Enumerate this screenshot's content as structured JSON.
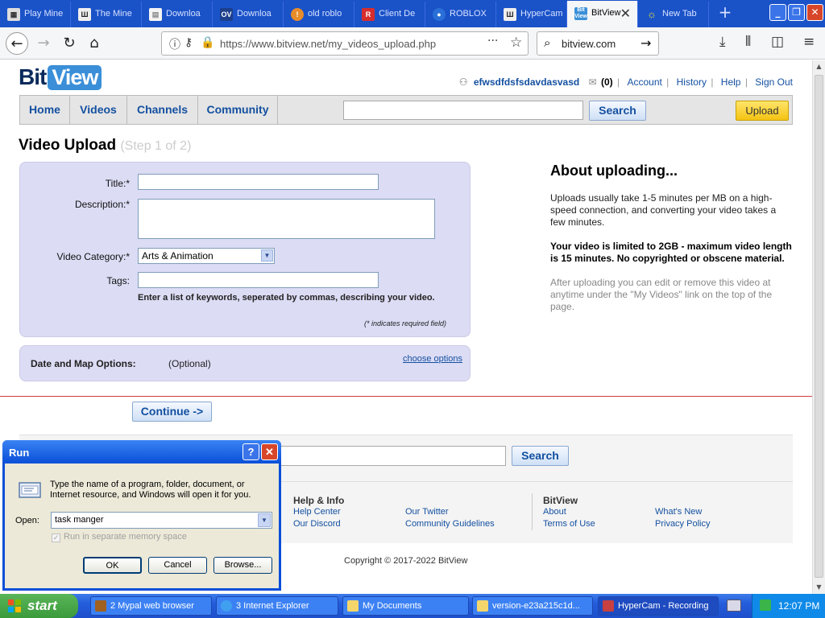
{
  "browser": {
    "tabs": [
      {
        "label": "Play Mine",
        "icon": "grid-icon"
      },
      {
        "label": "The Mine",
        "icon": "museum-icon"
      },
      {
        "label": "Downloa",
        "icon": "page-icon"
      },
      {
        "label": "Downloa",
        "icon": "ov-icon"
      },
      {
        "label": "old roblo",
        "icon": "roblox-icon"
      },
      {
        "label": "Client De",
        "icon": "roblox-r-icon"
      },
      {
        "label": "ROBLOX",
        "icon": "eye-icon"
      },
      {
        "label": "HyperCam",
        "icon": "museum-icon"
      },
      {
        "label": "BitView",
        "icon": "bitview-icon"
      },
      {
        "label": "New Tab",
        "icon": "bug-icon"
      }
    ],
    "url": "https://www.bitview.net/my_videos_upload.php",
    "search_value": "bitview.com"
  },
  "site": {
    "logo_bit": "Bit",
    "logo_view": "View",
    "username": "efwsdfdsfsdavdasvasd",
    "messages_count": "(0)",
    "user_links": [
      "Account",
      "History",
      "Help",
      "Sign Out"
    ],
    "nav": [
      "Home",
      "Videos",
      "Channels",
      "Community"
    ],
    "search_button": "Search",
    "upload_button": "Upload"
  },
  "upload": {
    "title": "Video Upload",
    "step": "(Step 1 of 2)",
    "title_label": "Title:*",
    "description_label": "Description:*",
    "category_label": "Video Category:*",
    "category_value": "Arts & Animation",
    "tags_label": "Tags:",
    "tags_hint": "Enter a list of keywords, seperated by commas, describing your video.",
    "required_note": "(* indicates required field)",
    "date_map_label": "Date and Map Options:",
    "optional": "(Optional)",
    "choose_options": "choose options",
    "continue_button": "Continue ->"
  },
  "about": {
    "heading": "About uploading...",
    "p1": "Uploads usually take 1-5 minutes per MB on a high-speed connection, and converting your video takes a few minutes.",
    "p2": "Your video is limited to 2GB - maximum video length is 15 minutes. No copyrighted or obscene material.",
    "p3": "After uploading you can edit or remove this video at anytime under the \"My Videos\" link on the top of the page."
  },
  "footer": {
    "search_button": "Search",
    "help_heading": "Help & Info",
    "bitview_heading": "BitView",
    "links": [
      "Help Center",
      "Our Discord",
      "Our Twitter",
      "Community Guidelines",
      "About",
      "Terms of Use",
      "What's New",
      "Privacy Policy"
    ],
    "copyright": "Copyright © 2017-2022 BitView"
  },
  "run_dialog": {
    "title": "Run",
    "message": "Type the name of a program, folder, document, or Internet resource, and Windows will open it for you.",
    "open_label": "Open:",
    "open_value": "task manger",
    "checkbox_label": "Run in separate memory space",
    "ok": "OK",
    "cancel": "Cancel",
    "browse": "Browse..."
  },
  "taskbar": {
    "start": "start",
    "tasks": [
      "2 Mypal web browser",
      "3 Internet Explorer",
      "My Documents",
      "version-e23a215c1d...",
      "HyperCam - Recording"
    ],
    "clock": "12:07 PM"
  }
}
